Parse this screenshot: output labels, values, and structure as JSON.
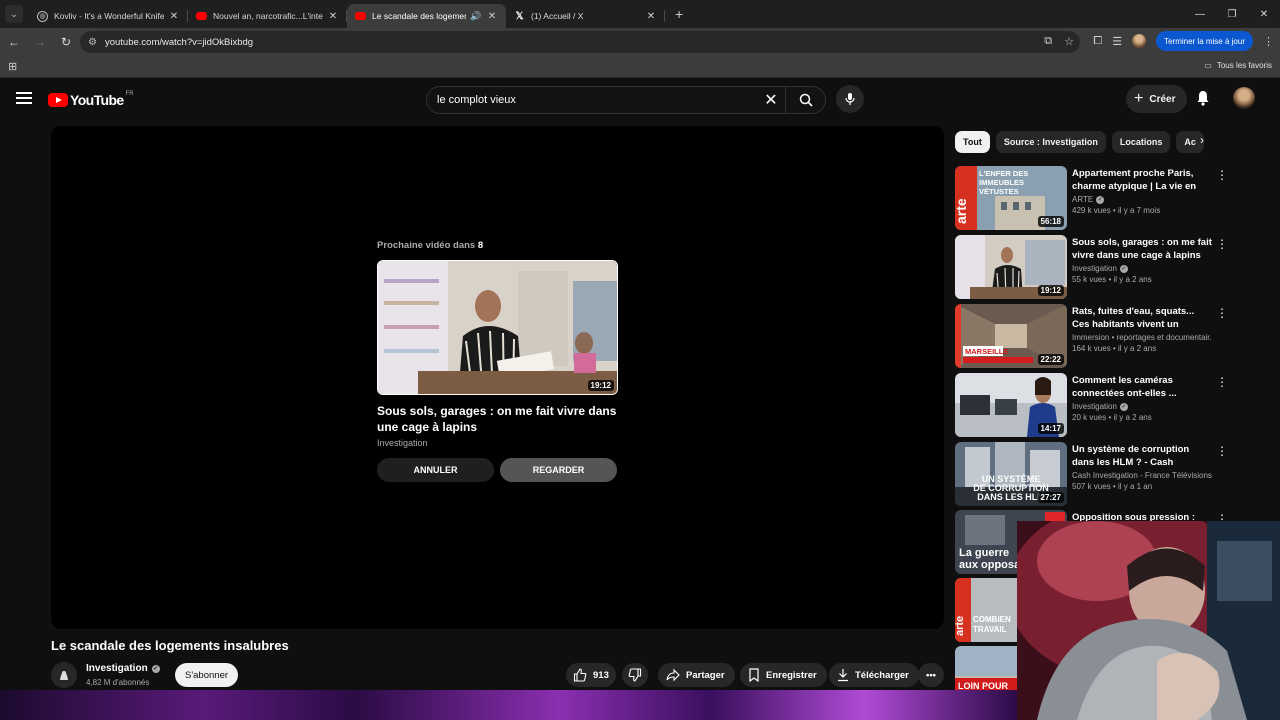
{
  "browser": {
    "tabs": [
      {
        "title": "Kovliv - It's a Wonderful Knife (",
        "icon": "globe-icon"
      },
      {
        "title": "Nouvel an, narcotrafic...L'intervi",
        "icon": "youtube-icon"
      },
      {
        "title": "Le scandale des logements",
        "icon": "youtube-icon",
        "active": true
      },
      {
        "title": "(1) Accueil / X",
        "icon": "x-icon"
      }
    ],
    "url": "youtube.com/watch?v=jidOkBixbdg",
    "update_button": "Terminer la mise à jour",
    "bookmarks_all": "Tous les favoris"
  },
  "youtube": {
    "logo_text": "YouTube",
    "region": "FR",
    "search_query": "le complot vieux",
    "create_label": "Créer",
    "up_next": {
      "label": "Prochaine vidéo dans",
      "countdown": "8",
      "title": "Sous sols, garages : on me fait vivre dans une cage à lapins",
      "channel": "Investigation",
      "duration": "19:12",
      "cancel": "ANNULER",
      "watch": "REGARDER"
    },
    "video": {
      "title": "Le scandale des logements insalubres",
      "channel": "Investigation",
      "subscribers": "4,82 M d'abonnés",
      "subscribe": "S'abonner",
      "likes": "913",
      "share": "Partager",
      "save": "Enregistrer",
      "download": "Télécharger"
    },
    "chips": [
      "Tout",
      "Source : Investigation",
      "Locations",
      "Ac"
    ],
    "recommendations": [
      {
        "title": "Appartement proche Paris, charme atypique | La vie en fa...",
        "channel": "ARTE",
        "verified": true,
        "views": "429 k vues",
        "age": "il y a 7 mois",
        "duration": "56:18",
        "thumb_text": "L'ENFER DES IMMEUBLES VÉTUSTES"
      },
      {
        "title": "Sous sols, garages : on me fait vivre dans une cage à lapins",
        "channel": "Investigation",
        "verified": true,
        "views": "55 k vues",
        "age": "il y a 2 ans",
        "duration": "19:12",
        "thumb_text": ""
      },
      {
        "title": "Rats, fuites d'eau, squats... Ces habitants vivent un calvaire !",
        "channel": "Immersion • reportages et documentair...",
        "verified": false,
        "views": "164 k vues",
        "age": "il y a 2 ans",
        "duration": "22:22",
        "thumb_text": "MARSEILLE"
      },
      {
        "title": "Comment les caméras connectées ont-elles ...",
        "channel": "Investigation",
        "verified": true,
        "views": "20 k vues",
        "age": "il y a 2 ans",
        "duration": "14:17",
        "thumb_text": ""
      },
      {
        "title": "Un système de corruption dans les HLM ? - Cash investigation",
        "channel": "Cash Investigation - France Télévisions",
        "verified": true,
        "views": "507 k vues",
        "age": "il y a 1 an",
        "duration": "27:27",
        "thumb_text": "UN SYSTÈME DE CORRUPTION DANS LES HLM"
      },
      {
        "title": "Opposition sous pression :",
        "channel": "",
        "verified": false,
        "views": "",
        "age": "",
        "duration": "",
        "thumb_text": "La guerre aux opposa"
      }
    ],
    "partial_thumbs": [
      "COMBIEN TRAVAIL",
      "LOIN POUR"
    ]
  }
}
